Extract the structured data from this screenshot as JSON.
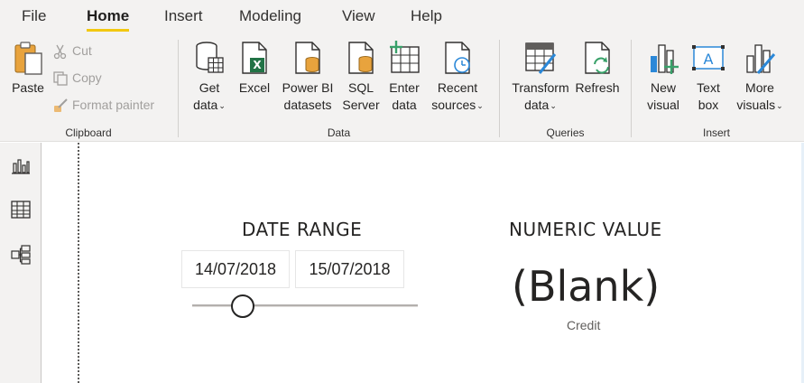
{
  "menu": {
    "tabs": [
      {
        "label": "File"
      },
      {
        "label": "Home"
      },
      {
        "label": "Insert"
      },
      {
        "label": "Modeling"
      },
      {
        "label": "View"
      },
      {
        "label": "Help"
      }
    ],
    "active": "Home"
  },
  "ribbon": {
    "clipboard": {
      "label": "Clipboard",
      "paste": "Paste",
      "cut": "Cut",
      "copy": "Copy",
      "format_painter": "Format painter"
    },
    "data": {
      "label": "Data",
      "get_data": [
        "Get",
        "data"
      ],
      "excel": "Excel",
      "powerbi": [
        "Power BI",
        "datasets"
      ],
      "sql": [
        "SQL",
        "Server"
      ],
      "enter": [
        "Enter",
        "data"
      ],
      "recent": [
        "Recent",
        "sources"
      ]
    },
    "queries": {
      "label": "Queries",
      "transform": [
        "Transform",
        "data"
      ],
      "refresh": "Refresh"
    },
    "insert": {
      "label": "Insert",
      "new_visual": [
        "New",
        "visual"
      ],
      "text_box": [
        "Text",
        "box"
      ],
      "more_visuals": [
        "More",
        "visuals"
      ]
    }
  },
  "report": {
    "date_range": {
      "title": "DATE RANGE",
      "start": "14/07/2018",
      "end": "15/07/2018",
      "slider_position": 0.2
    },
    "numeric_card": {
      "title": "NUMERIC VALUE",
      "value": "(Blank)",
      "label": "Credit"
    }
  },
  "colors": {
    "accent": "#f2c811",
    "ribbon_bg": "#f3f2f1",
    "excel_green": "#217346",
    "database_orange": "#e8a33d",
    "chart_blue": "#2b88d8",
    "plus_green": "#38a169"
  },
  "icons": {
    "left_rail": [
      "report-view-icon",
      "data-view-icon",
      "model-view-icon"
    ]
  }
}
